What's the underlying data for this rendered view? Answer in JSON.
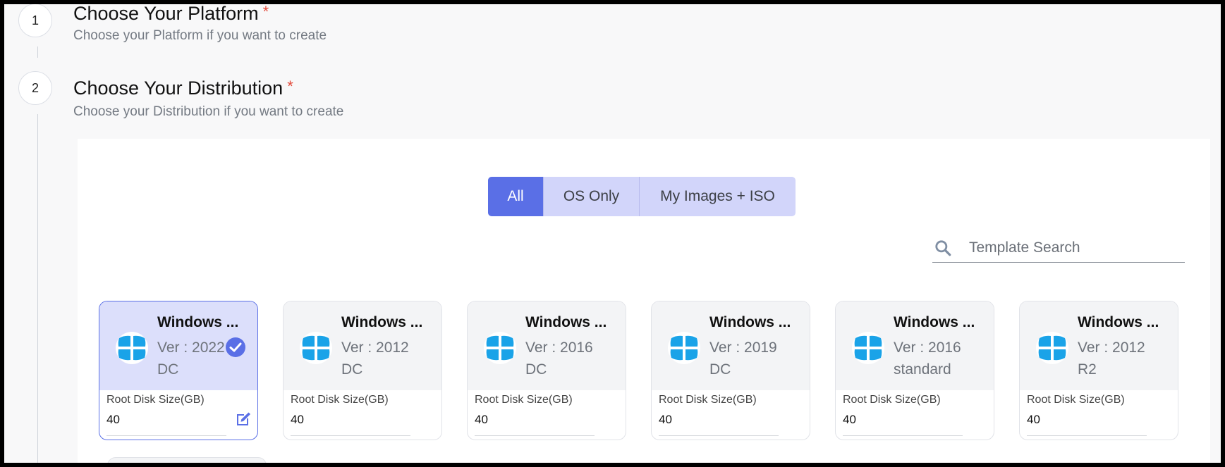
{
  "steps": [
    {
      "number": "1",
      "title": "Choose Your Platform",
      "required": "*",
      "subtitle": "Choose your Platform if you want to create"
    },
    {
      "number": "2",
      "title": "Choose Your Distribution",
      "required": "*",
      "subtitle": "Choose your Distribution if you want to create"
    }
  ],
  "filters": {
    "active": "All",
    "items": [
      "All",
      "OS Only",
      "My Images + ISO"
    ]
  },
  "search": {
    "placeholder": "Template Search",
    "value": ""
  },
  "templates": [
    {
      "name": "Windows ...",
      "version_line1": "Ver : 2022",
      "version_line2": "DC",
      "disk_label": "Root Disk Size(GB)",
      "disk_value": "40",
      "selected": true
    },
    {
      "name": "Windows ...",
      "version_line1": "Ver : 2012",
      "version_line2": "DC",
      "disk_label": "Root Disk Size(GB)",
      "disk_value": "40",
      "selected": false
    },
    {
      "name": "Windows ...",
      "version_line1": "Ver : 2016",
      "version_line2": "DC",
      "disk_label": "Root Disk Size(GB)",
      "disk_value": "40",
      "selected": false
    },
    {
      "name": "Windows ...",
      "version_line1": "Ver : 2019",
      "version_line2": "DC",
      "disk_label": "Root Disk Size(GB)",
      "disk_value": "40",
      "selected": false
    },
    {
      "name": "Windows ...",
      "version_line1": "Ver : 2016",
      "version_line2": "standard",
      "disk_label": "Root Disk Size(GB)",
      "disk_value": "40",
      "selected": false
    },
    {
      "name": "Windows ...",
      "version_line1": "Ver : 2012",
      "version_line2": "R2",
      "disk_label": "Root Disk Size(GB)",
      "disk_value": "40",
      "selected": false
    }
  ],
  "icons": {
    "os_logo": "windows-logo-icon",
    "selected": "check-circle-icon",
    "edit": "edit-icon",
    "search": "search-icon"
  },
  "colors": {
    "accent": "#5a6fe6",
    "windows_blue": "#1aa3e8",
    "required": "#e34b3c"
  }
}
